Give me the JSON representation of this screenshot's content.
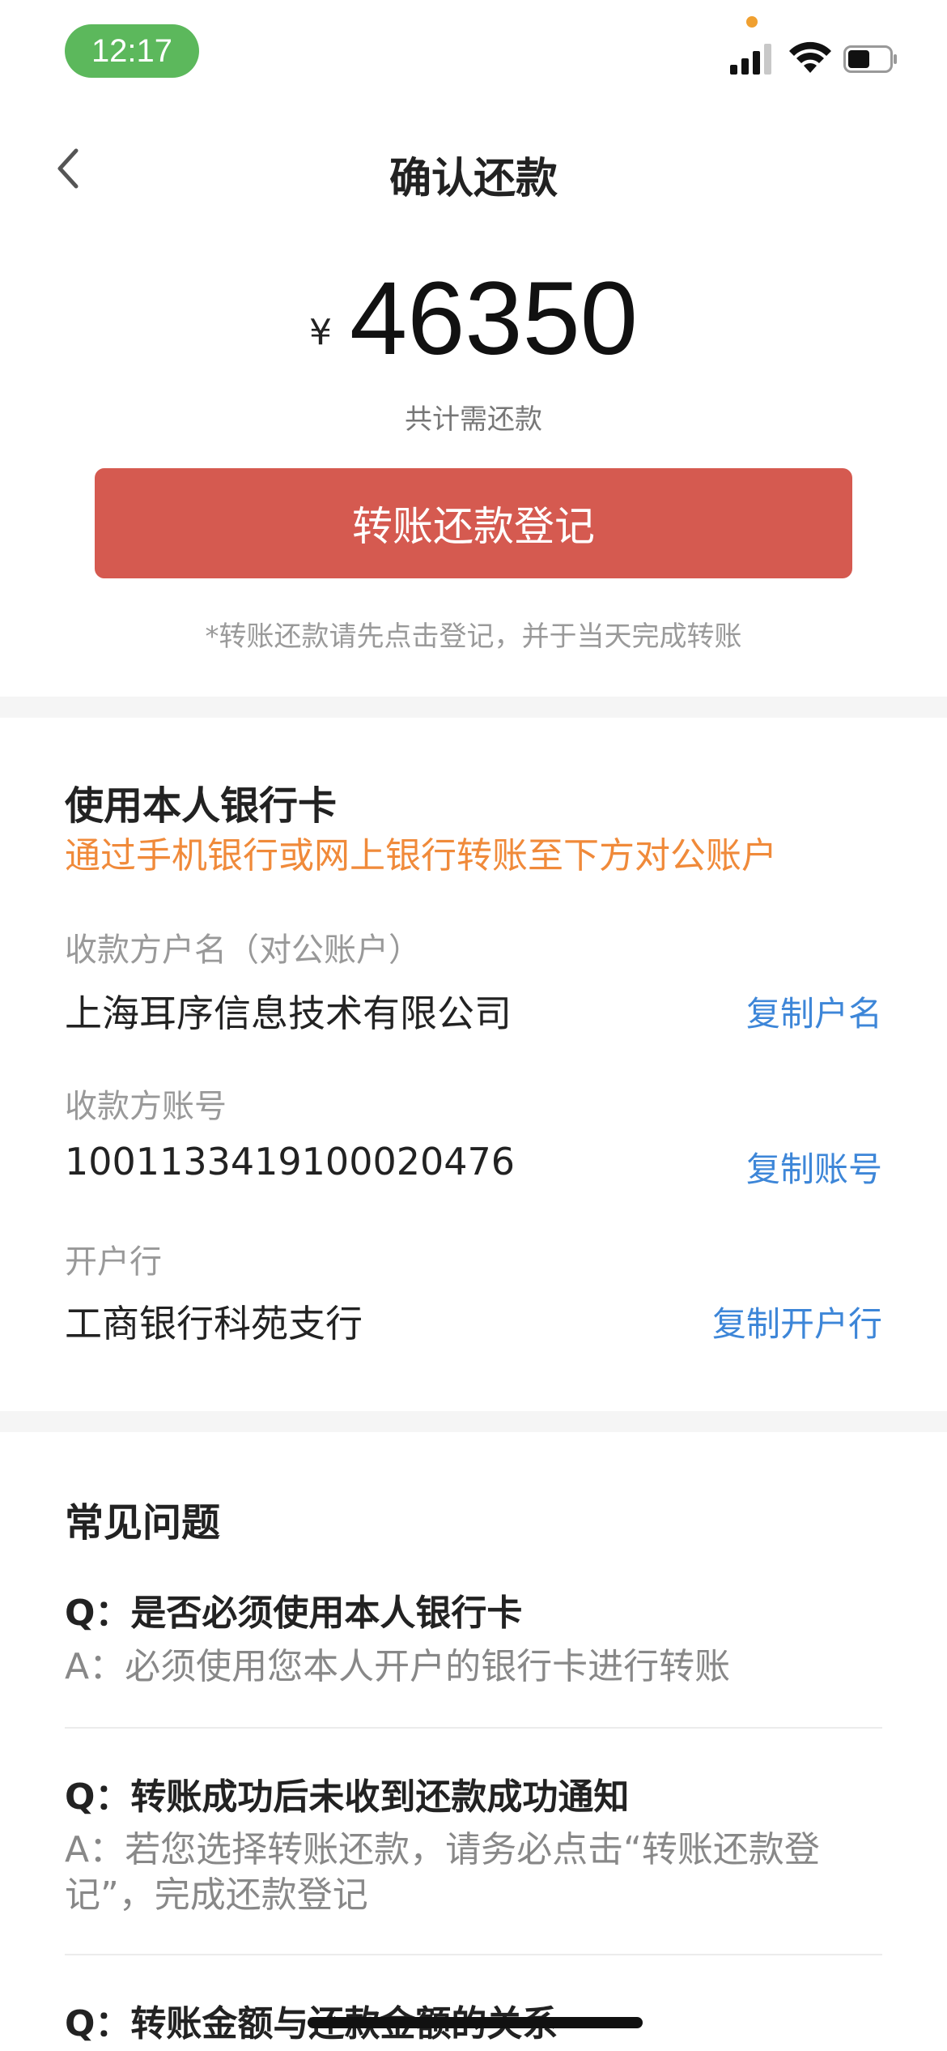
{
  "status_bar": {
    "time": "12:17",
    "icons": [
      "signal-icon",
      "wifi-icon",
      "battery-icon"
    ]
  },
  "nav": {
    "title": "确认还款",
    "back_icon": "chevron-left-icon"
  },
  "amount": {
    "currency": "¥",
    "value": "46350",
    "caption": "共计需还款"
  },
  "primary_button": {
    "label": "转账还款登记"
  },
  "hint": "*转账还款请先点击登记，并于当天完成转账",
  "bank_section": {
    "title": "使用本人银行卡",
    "subtitle": "通过手机银行或网上银行转账至下方对公账户",
    "fields": [
      {
        "label": "收款方户名（对公账户）",
        "value": "上海耳序信息技术有限公司",
        "action": "复制户名"
      },
      {
        "label": "收款方账号",
        "value": "1001133419100020476",
        "action": "复制账号"
      },
      {
        "label": "开户行",
        "value": "工商银行科苑支行",
        "action": "复制开户行"
      }
    ]
  },
  "faq": {
    "title": "常见问题",
    "items": [
      {
        "q": "Q：是否必须使用本人银行卡",
        "a": "A：必须使用您本人开户的银行卡进行转账"
      },
      {
        "q": "Q：转账成功后未收到还款成功通知",
        "a": "A：若您选择转账还款，请务必点击“转账还款登记”，完成还款登记"
      },
      {
        "q": "Q：转账金额与还款金额的关系",
        "a": ""
      }
    ]
  },
  "colors": {
    "accent_red": "#d55a50",
    "orange_text": "#f08a3a",
    "link_blue": "#3d86d8",
    "status_green": "#5cb85c"
  }
}
